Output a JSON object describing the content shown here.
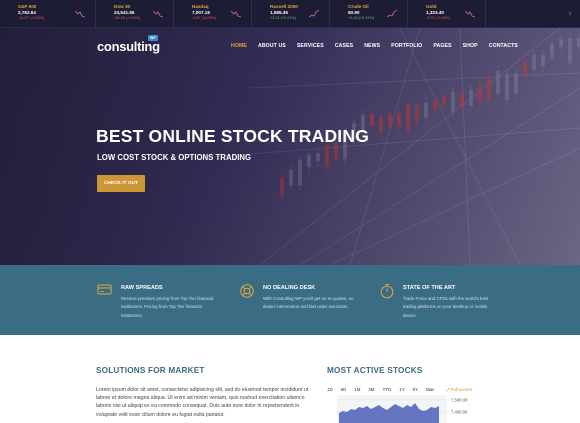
{
  "ticker": {
    "items": [
      {
        "name": "S&P 500",
        "price": "2,762.64",
        "change": "-14.57 (-0.53%)",
        "trend": "down"
      },
      {
        "name": "Dow 30",
        "price": "24,541.55",
        "change": "-98.49 (-0.40%)",
        "trend": "down"
      },
      {
        "name": "Nasdaq",
        "price": "7,007.15",
        "change": "-3.87 (-0.05%)",
        "trend": "down"
      },
      {
        "name": "Russell 2000",
        "price": "1,585.36",
        "change": "+3.31 (+0.21%)",
        "trend": "up"
      },
      {
        "name": "Crude Oil",
        "price": "60.90",
        "change": "+0.18 (+0.31%)",
        "trend": "up"
      },
      {
        "name": "Gold",
        "price": "1,323.40",
        "change": "-3.70 (-0.28%)",
        "trend": "down"
      }
    ],
    "next_arrow": "›"
  },
  "brand": {
    "name": "consulting",
    "badge": "WP"
  },
  "nav": {
    "items": [
      "HOME",
      "ABOUT US",
      "SERVICES",
      "CASES",
      "NEWS",
      "PORTFOLIO",
      "PAGES",
      "SHOP",
      "CONTACTS"
    ],
    "active_index": 0
  },
  "hero": {
    "title": "BEST ONLINE STOCK TRADING",
    "subtitle": "LOW COST STOCK & OPTIONS TRADING",
    "cta": "CHECK IT OUT"
  },
  "features": [
    {
      "icon": "card-icon",
      "title": "RAW SPREADS",
      "desc": "Receive premium pricing from Top Tier financial institutions. Pricing from Top Tier financial institutions."
    },
    {
      "icon": "lifebuoy-icon",
      "title": "NO DEALING DESK",
      "desc": "With Consulting WP you'll get no re-quotes, no dealer intervention and fast order execution."
    },
    {
      "icon": "stopwatch-icon",
      "title": "STATE OF THE ART",
      "desc": "Trade Forex and CFDs with the world's best trading platforms on your desktop or mobile device."
    }
  ],
  "solutions": {
    "title": "SOLUTIONS FOR MARKET",
    "text": "Lorem ipsum dolor sit amet, consectetur adipisicing elit, sed do eiusmod tempor incididunt ut labore et dolore magna aliqua. Ut enim ad minim veniam, quis nostrud exercitation ullamco laboris nisi ut aliquip ex ea commodo consequat. Duis aute irure dolor in reprehenderit in voluptate velit esse cillum dolore eu fugiat nulla pariatur."
  },
  "most_active": {
    "title": "MOST ACTIVE STOCKS",
    "ranges": [
      "1D",
      "5D",
      "1M",
      "3M",
      "YTD",
      "1Y",
      "5Y",
      "Max"
    ],
    "fullscreen_label": "Full screen",
    "y_labels": [
      "7,500.00",
      "7,400.00"
    ]
  },
  "colors": {
    "accent": "#cd9637",
    "nav_active": "#e3a63c",
    "feature_bg": "#3a6c83",
    "heading": "#3b6c84"
  }
}
